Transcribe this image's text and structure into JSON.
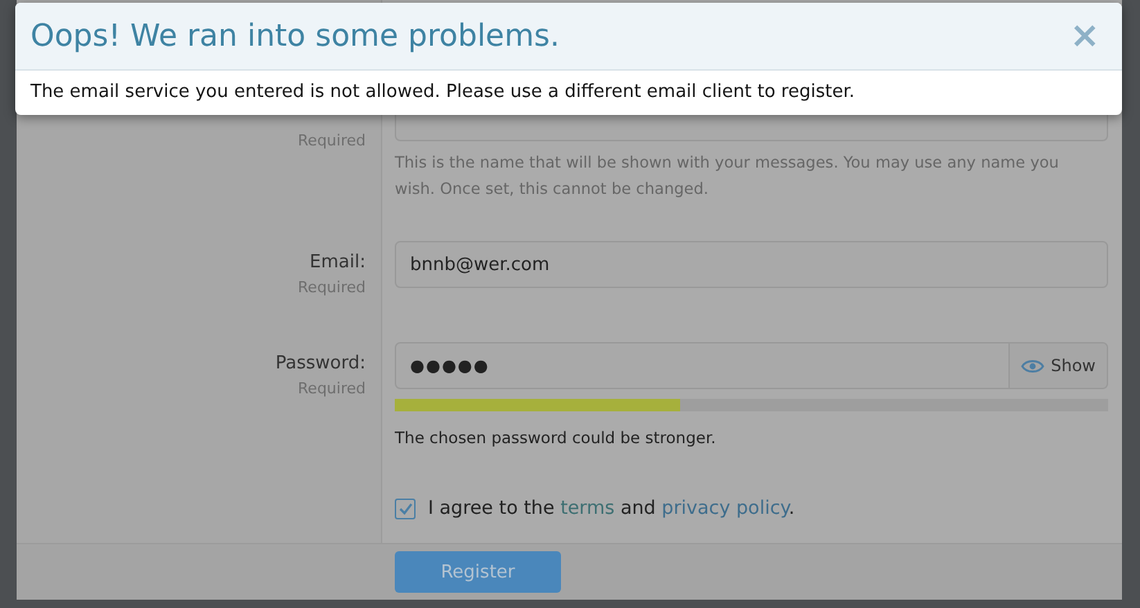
{
  "error_dialog": {
    "title": "Oops! We ran into some problems.",
    "close": "×",
    "message": "The email service you entered is not allowed. Please use a different email client to register."
  },
  "form": {
    "fields": [
      {
        "kind": "text",
        "required": "Required",
        "hint": "This is the name that will be shown with your messages. You may use any name you wish. Once set, this cannot be changed."
      },
      {
        "kind": "text",
        "label": "Email:",
        "required": "Required",
        "value": "bnnb@wer.com"
      },
      {
        "kind": "password",
        "label": "Password:",
        "required": "Required",
        "value": "●●●●●",
        "show_button": "Show",
        "level": 0.4,
        "hint": "The chosen password could be stronger."
      }
    ],
    "agreement": {
      "checked": true,
      "before": "I agree to the",
      "link1": "terms",
      "middle": "and",
      "link2": "privacy policy",
      "after": "."
    },
    "submit": "Register"
  }
}
